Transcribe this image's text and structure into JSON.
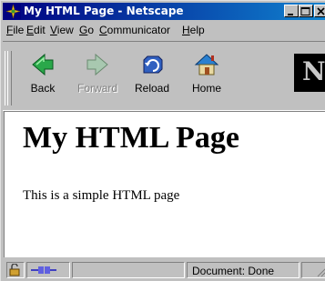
{
  "window": {
    "title": "My HTML Page - Netscape",
    "controls": [
      "minimize",
      "maximize",
      "close"
    ]
  },
  "menu": [
    {
      "label": "File",
      "accel": "F"
    },
    {
      "label": "Edit",
      "accel": "E"
    },
    {
      "label": "View",
      "accel": "V"
    },
    {
      "label": "Go",
      "accel": "G"
    },
    {
      "label": "Communicator",
      "accel": "C"
    },
    {
      "label": "Help",
      "accel": "H"
    }
  ],
  "toolbar": {
    "buttons": [
      {
        "label": "Back",
        "icon": "back-arrow-icon",
        "enabled": true
      },
      {
        "label": "Forward",
        "icon": "forward-arrow-icon",
        "enabled": false
      },
      {
        "label": "Reload",
        "icon": "reload-icon",
        "enabled": true
      },
      {
        "label": "Home",
        "icon": "home-icon",
        "enabled": true
      }
    ],
    "throbber_letter": "N"
  },
  "page": {
    "heading": "My HTML Page",
    "paragraph": "This is a simple HTML page"
  },
  "status": {
    "text": "Document: Done"
  },
  "colors": {
    "titlebar_start": "#000080",
    "titlebar_end": "#1084d0",
    "chrome": "#c0c0c0",
    "content_bg": "#ffffff"
  }
}
